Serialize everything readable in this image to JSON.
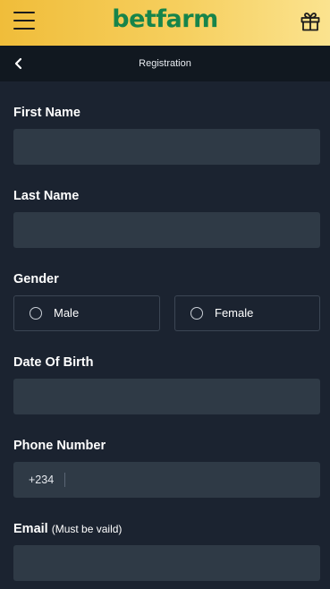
{
  "header": {
    "logo_text": "betfarm",
    "menu_icon": "hamburger-menu-icon",
    "gift_icon": "gift-icon",
    "brand_color": "#17844a"
  },
  "subheader": {
    "title": "Registration",
    "back_icon": "chevron-left-icon"
  },
  "form": {
    "first_name": {
      "label": "First Name",
      "value": ""
    },
    "last_name": {
      "label": "Last Name",
      "value": ""
    },
    "gender": {
      "label": "Gender",
      "options": [
        "Male",
        "Female"
      ],
      "selected": null
    },
    "dob": {
      "label": "Date Of Birth",
      "value": ""
    },
    "phone": {
      "label": "Phone Number",
      "prefix": "+234",
      "value": ""
    },
    "email": {
      "label": "Email",
      "note": "(Must be vaild)",
      "value": ""
    }
  }
}
